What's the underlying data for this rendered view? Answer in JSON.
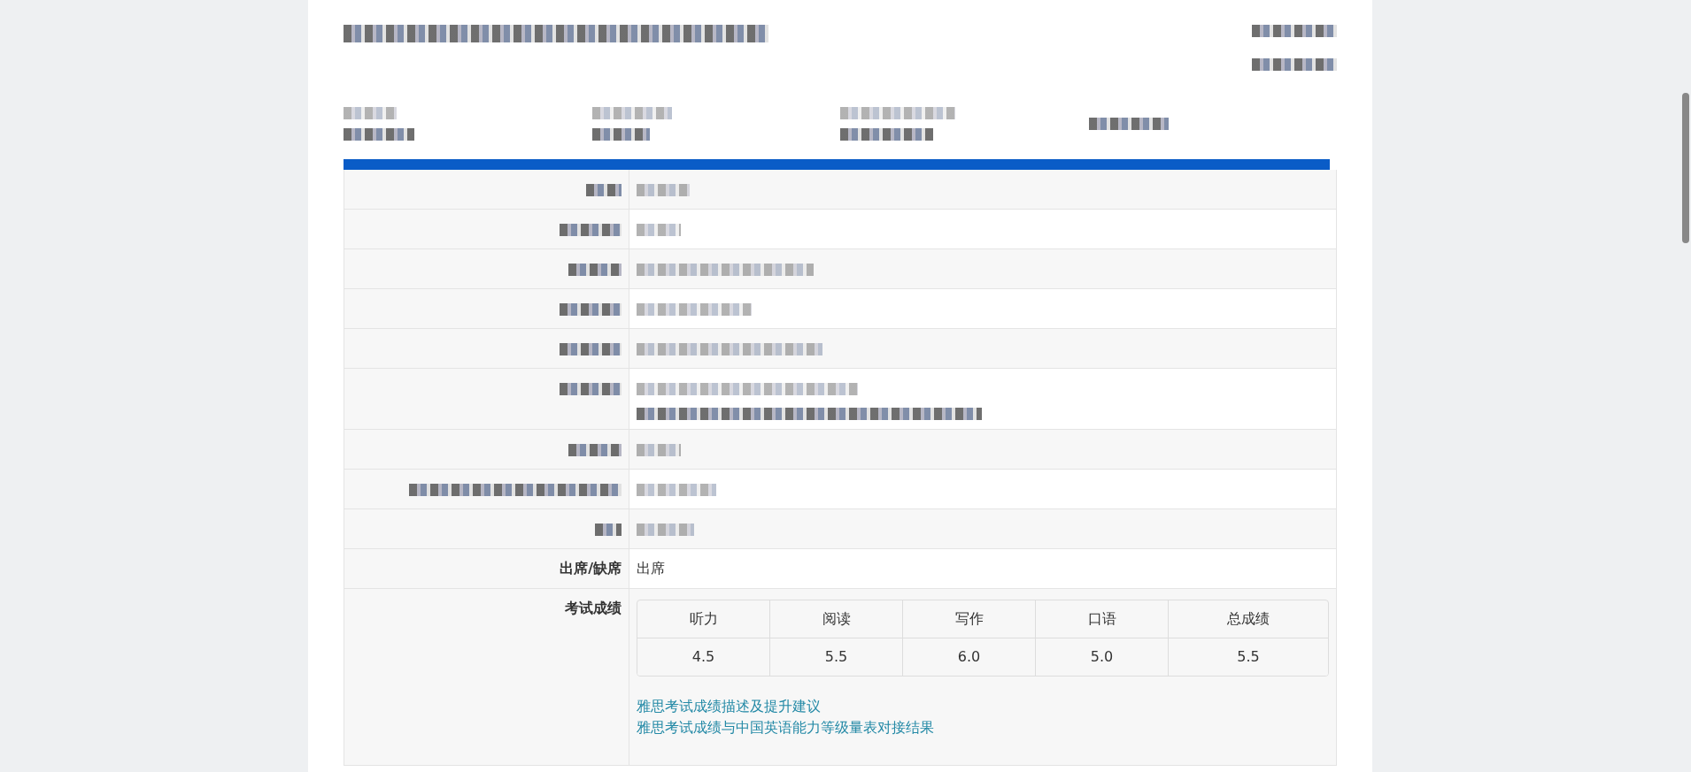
{
  "details": [
    {
      "label": "出席/缺席",
      "value": "出席"
    }
  ],
  "scores": {
    "label": "考试成绩",
    "columns": [
      "听力",
      "阅读",
      "写作",
      "口语",
      "总成绩"
    ],
    "values": [
      "4.5",
      "5.5",
      "6.0",
      "5.0",
      "5.5"
    ]
  },
  "links": [
    "雅思考试成绩描述及提升建议",
    "雅思考试成绩与中国英语能力等级量表对接结果"
  ]
}
